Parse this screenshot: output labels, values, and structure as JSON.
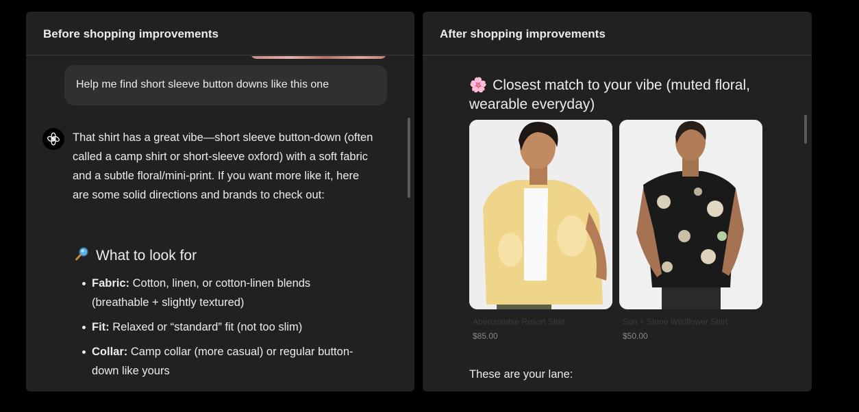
{
  "before": {
    "title": "Before shopping improvements",
    "user_message": "Help me find short sleeve button downs like this one",
    "assistant_intro": "That shirt has a great vibe—short sleeve button-down (often called a camp shirt or short-sleeve oxford) with a soft fabric and a subtle floral/mini-print. If you want more like it, here are some solid directions and brands to check out:",
    "section_heading": "What to look for",
    "section_icon": "magnifier-icon",
    "bullets": [
      {
        "label": "Fabric:",
        "text": "Cotton, linen, or cotton-linen blends (breathable + slightly textured)"
      },
      {
        "label": "Fit:",
        "text": "Relaxed or “standard” fit (not too slim)"
      },
      {
        "label": "Collar:",
        "text": "Camp collar (more casual) or regular button-down like yours"
      }
    ]
  },
  "after": {
    "title": "After shopping improvements",
    "heading_emoji": "🌸",
    "heading": "Closest match to your vibe (muted floral, wearable everyday)",
    "products": [
      {
        "name": "Abercrombie Resort Shirt",
        "price": "$85.00",
        "image": "yellow-floral-resort-shirt"
      },
      {
        "name": "Sun + Stone Wildflower Shirt",
        "price": "$50.00",
        "image": "black-floral-shirt"
      }
    ],
    "lane_text": "These are your lane:"
  },
  "colors": {
    "page_bg": "#000000",
    "panel_bg": "#212121",
    "bubble_bg": "#303030",
    "text": "#ececec"
  }
}
